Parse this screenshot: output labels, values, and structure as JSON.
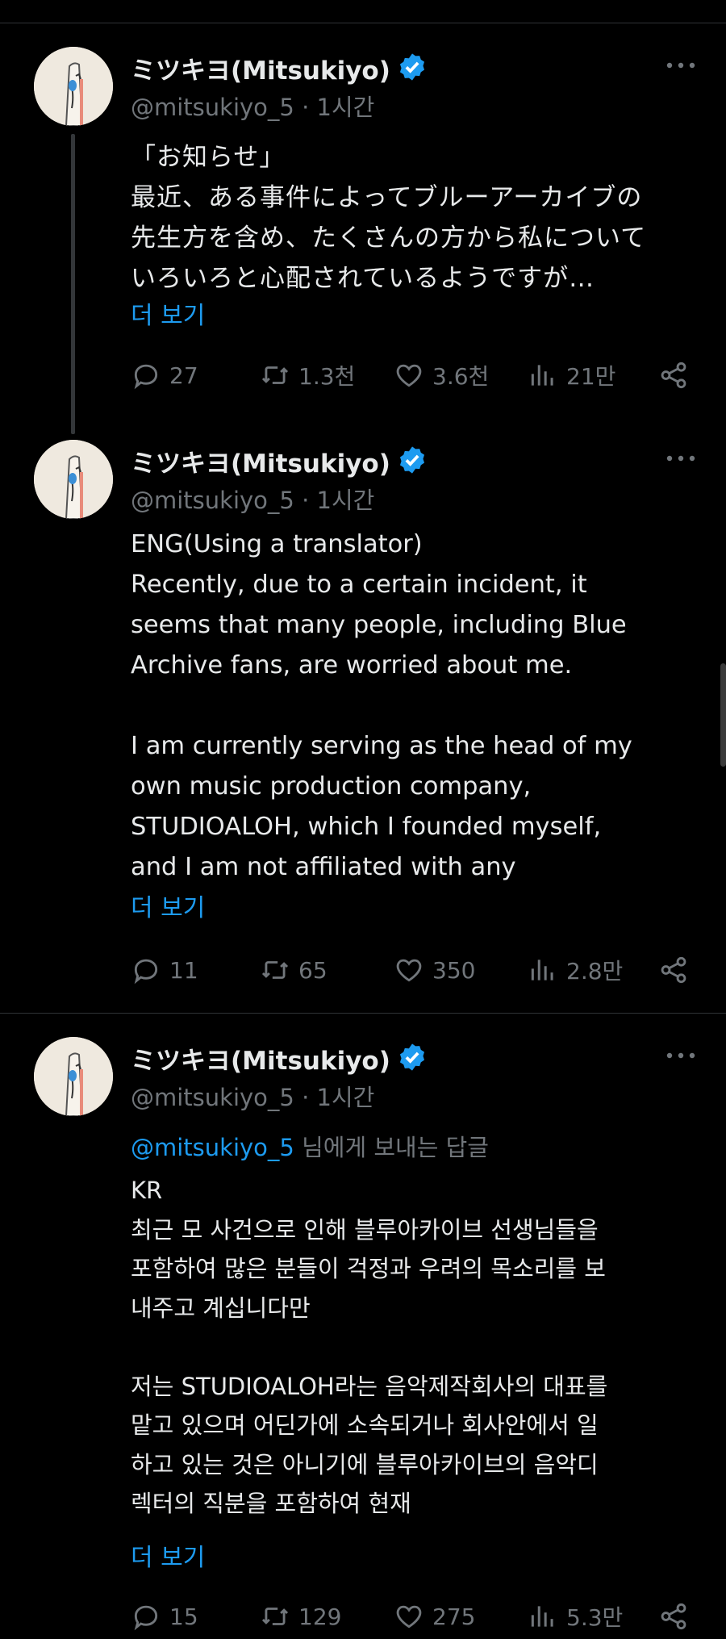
{
  "tweets": [
    {
      "author": "ミツキヨ(Mitsukiyo)",
      "handle_time": "@mitsukiyo_5 · 1시간",
      "body": "「お知らせ」\n最近、ある事件によってブルーアーカイブの\n先生方を含め、たくさんの方から私について\nいろいろと心配されているようですが…",
      "show_more": "더 보기",
      "replies": "27",
      "reposts": "1.3천",
      "likes": "3.6천",
      "views": "21만"
    },
    {
      "author": "ミツキヨ(Mitsukiyo)",
      "handle_time": "@mitsukiyo_5 · 1시간",
      "body": "ENG(Using a translator)\nRecently, due to a certain incident, it\nseems that many people, including Blue\nArchive fans, are worried about me.\n\nI am currently serving as the head of my\nown music production company,\nSTUDIOALOH, which I founded myself,\nand I am not affiliated with any",
      "show_more": "더 보기",
      "replies": "11",
      "reposts": "65",
      "likes": "350",
      "views": "2.8만"
    },
    {
      "author": "ミツキヨ(Mitsukiyo)",
      "handle_time": "@mitsukiyo_5 · 1시간",
      "reply_mention": "@mitsukiyo_5",
      "reply_text": " 님에게 보내는 답글",
      "body": "KR\n최근 모 사건으로 인해 블루아카이브 선생님들을\n포함하여 많은 분들이 걱정과 우려의 목소리를 보\n내주고 계십니다만\n\n저는 STUDIOALOH라는 음악제작회사의 대표를\n맡고 있으며 어딘가에 소속되거나 회사안에서 일\n하고 있는 것은 아니기에 블루아카이브의 음악디\n렉터의 직분을 포함하여 현재",
      "show_more": "더 보기",
      "replies": "15",
      "reposts": "129",
      "likes": "275",
      "views": "5.3만"
    }
  ],
  "icons": {
    "verified": "verified-badge-icon",
    "more": "more-dots-icon",
    "reply": "reply-icon",
    "repost": "repost-icon",
    "like": "heart-icon",
    "views": "views-chart-icon",
    "share": "share-icon"
  },
  "colors": {
    "accent": "#1d9bf0",
    "muted": "#71767b",
    "text": "#e7e9ea",
    "background": "#000000"
  }
}
